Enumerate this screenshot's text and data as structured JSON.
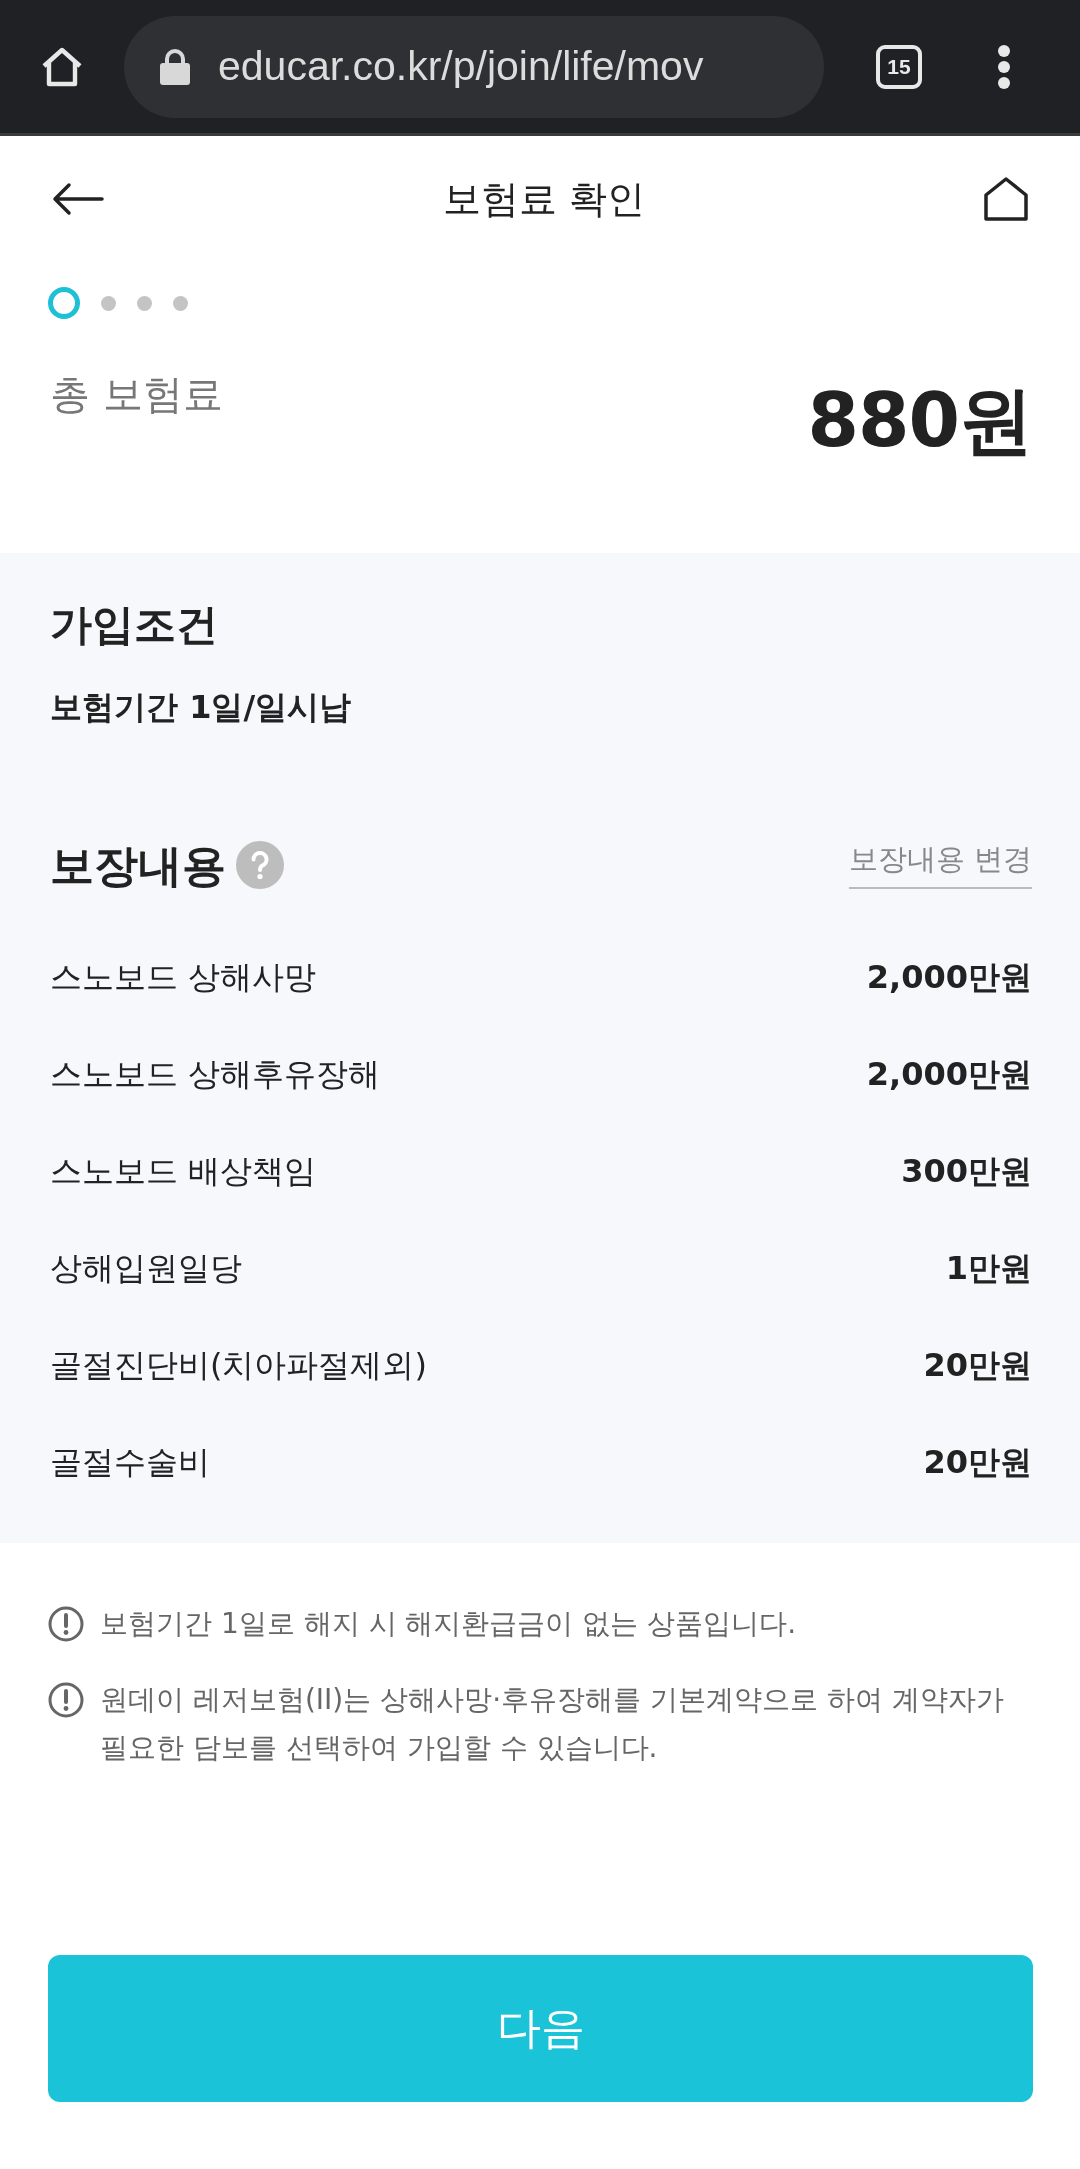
{
  "browser": {
    "url": "educar.co.kr/p/join/life/mov",
    "tab_count": "15"
  },
  "header": {
    "title": "보험료 확인"
  },
  "steps": [
    {
      "selected": true
    },
    {
      "selected": false
    },
    {
      "selected": false
    },
    {
      "selected": false
    }
  ],
  "total": {
    "label": "총 보험료",
    "amount": "880원"
  },
  "conditions": {
    "title": "가입조건",
    "text": "보험기간 1일/일시납"
  },
  "coverage": {
    "title": "보장내용",
    "change_link": "보장내용 변경",
    "items": [
      {
        "name": "스노보드 상해사망",
        "amount": "2,000만원"
      },
      {
        "name": "스노보드 상해후유장해",
        "amount": "2,000만원"
      },
      {
        "name": "스노보드 배상책임",
        "amount": "300만원"
      },
      {
        "name": "상해입원일당",
        "amount": "1만원"
      },
      {
        "name": "골절진단비(치아파절제외)",
        "amount": "20만원"
      },
      {
        "name": "골절수술비",
        "amount": "20만원"
      }
    ]
  },
  "notes": [
    "보험기간 1일로 해지 시 해지환급금이 없는 상품입니다.",
    "원데이 레저보험(II)는 상해사망·후유장해를 기본계약으로 하여 계약자가 필요한 담보를 선택하여 가입할 수 있습니다."
  ],
  "next_button": "다음"
}
